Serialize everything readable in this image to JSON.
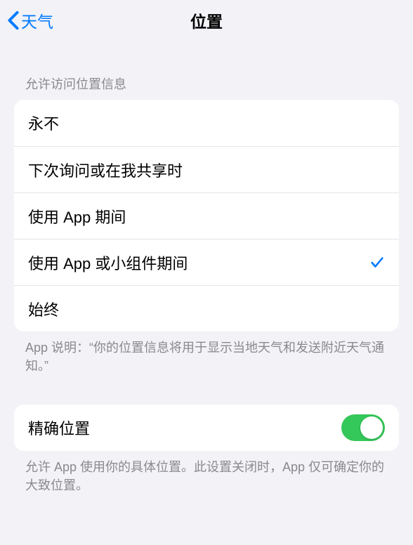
{
  "nav": {
    "back_label": "天气",
    "title": "位置"
  },
  "section1": {
    "header": "允许访问位置信息",
    "options": [
      {
        "label": "永不",
        "selected": false
      },
      {
        "label": "下次询问或在我共享时",
        "selected": false
      },
      {
        "label": "使用 App 期间",
        "selected": false
      },
      {
        "label": "使用 App 或小组件期间",
        "selected": true
      },
      {
        "label": "始终",
        "selected": false
      }
    ],
    "footer": "App 说明：“你的位置信息将用于显示当地天气和发送附近天气通知。”"
  },
  "section2": {
    "precise_location": {
      "label": "精确位置",
      "enabled": true
    },
    "footer": "允许 App 使用你的具体位置。此设置关闭时，App 仅可确定你的大致位置。"
  }
}
